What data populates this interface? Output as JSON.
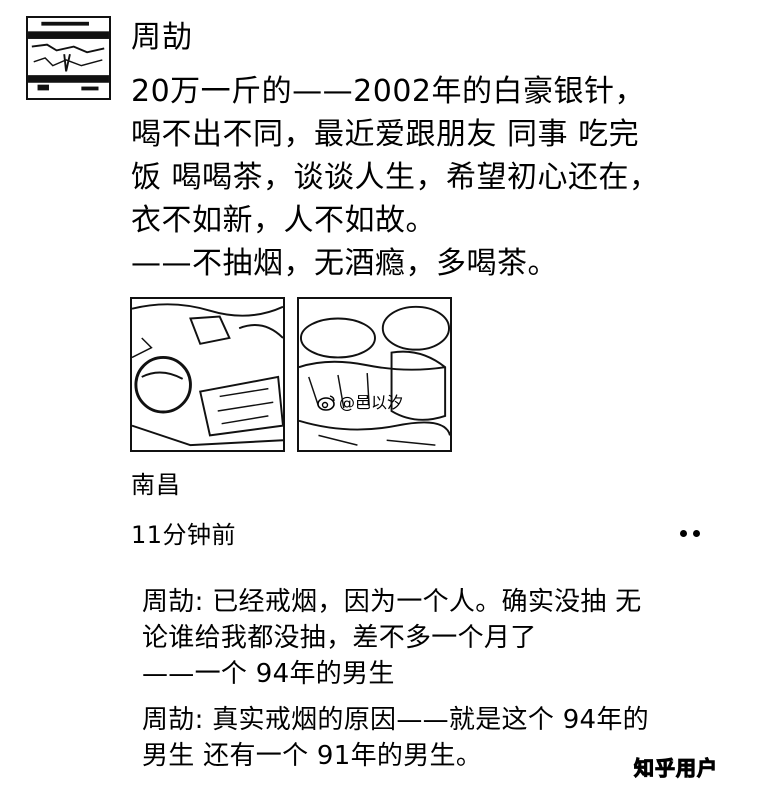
{
  "post": {
    "author": "周劼",
    "body_lines": [
      "20万一斤的——2002年的白豪银针，",
      "喝不出不同，最近爱跟朋友 同事 吃完",
      "饭 喝喝茶，谈谈人生，希望初心还在，",
      "衣不如新，人不如故。",
      "——不抽烟，无酒瘾，多喝茶。"
    ],
    "photo_watermark": "@邑以汐",
    "location": "南昌",
    "timestamp": "11分钟前"
  },
  "comments": [
    {
      "lines": [
        "周劼: 已经戒烟，因为一个人。确实没抽 无",
        "论谁给我都没抽，差不多一个月了",
        "——一个 94年的男生"
      ]
    },
    {
      "lines": [
        "周劼: 真实戒烟的原因——就是这个 94年的",
        "男生 还有一个  91年的男生。"
      ]
    }
  ],
  "site_watermark": "知乎用户",
  "icons": {
    "avatar": "avatar-image",
    "more": "more-dots-icon",
    "watermark_logo": "weibo-logo-icon"
  },
  "colors": {
    "text": "#000000",
    "background": "#ffffff"
  }
}
